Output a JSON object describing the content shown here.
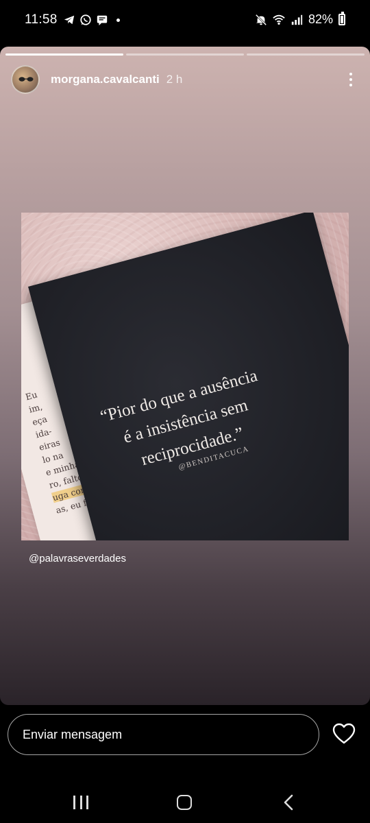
{
  "status_bar": {
    "time": "11:58",
    "notification_icons": [
      "telegram-icon",
      "whatsapp-icon",
      "messages-icon"
    ],
    "battery_percent": "82%",
    "system_icons": [
      "mute-icon",
      "wifi-icon",
      "signal-icon",
      "battery-icon"
    ]
  },
  "story": {
    "progress_segments": 3,
    "active_segment": 1,
    "username": "morgana.cavalcanti",
    "time_ago": "2 h",
    "image": {
      "quote_lines": [
        "“Pior do que a ausência",
        "é a insistência sem",
        "reciprocidade.”"
      ],
      "quote_author": "@BENDITACUCA",
      "page_text_lines": [
        "Eu",
        "im,",
        "eça",
        "ida-",
        "eiras",
        "lo na",
        "e minha,",
        "ro, faltou",
        "uga com",
        "as, eu faria"
      ]
    },
    "mention": "@palavraseverdades"
  },
  "reply_bar": {
    "placeholder": "Enviar mensagem"
  },
  "colors": {
    "story_bg_top": "#cdb3b0",
    "story_bg_bottom": "#2a2329",
    "book_cover": "#1f2026"
  }
}
